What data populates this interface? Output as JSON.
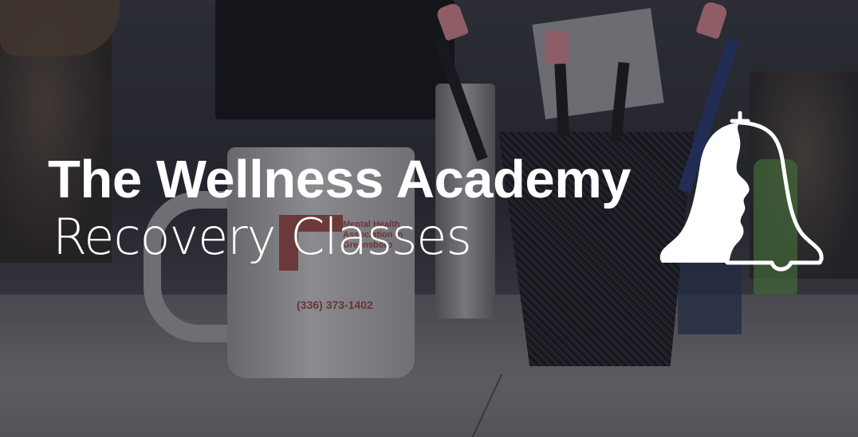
{
  "banner": {
    "title": "The Wellness Academy",
    "subtitle": "Recovery Classes",
    "logo_icon": "bell-profile-icon",
    "background_photo": {
      "mug_text": "Mental Health Association in Greensboro",
      "mug_phone": "(336) 373-1402"
    }
  },
  "colors": {
    "text": "#ffffff",
    "mug_logo": "#9a3b36"
  }
}
